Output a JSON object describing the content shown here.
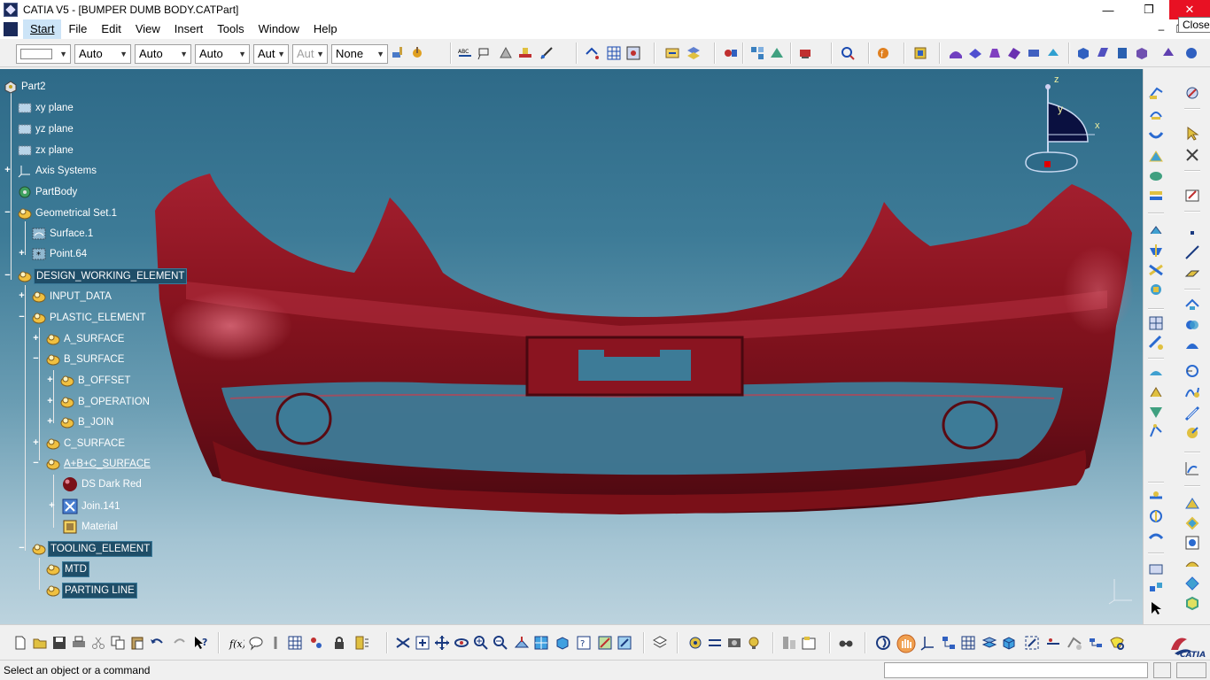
{
  "window": {
    "title": "CATIA V5 - [BUMPER DUMB BODY.CATPart]",
    "minimize_glyph": "—",
    "maximize_glyph": "❐",
    "close_glyph": "✕",
    "close_tooltip": "Close"
  },
  "menu": {
    "items": [
      "Start",
      "File",
      "Edit",
      "View",
      "Insert",
      "Tools",
      "Window",
      "Help"
    ],
    "mdi_minimize": "–",
    "mdi_restore": "❐",
    "mdi_close": "✕"
  },
  "toolbar_top": {
    "combos": [
      "",
      "Auto",
      "Auto",
      "Auto",
      "Aut",
      "Aut",
      "None"
    ]
  },
  "tree": {
    "nodes": [
      {
        "label": "Part2",
        "icon": "part-icon"
      },
      {
        "label": "xy plane",
        "icon": "plane-icon"
      },
      {
        "label": "yz plane",
        "icon": "plane-icon"
      },
      {
        "label": "zx plane",
        "icon": "plane-icon"
      },
      {
        "label": "Axis Systems",
        "icon": "axis-system-icon"
      },
      {
        "label": "PartBody",
        "icon": "partbody-icon"
      },
      {
        "label": "Geometrical Set.1",
        "icon": "geometrical-set-icon"
      },
      {
        "label": "Surface.1",
        "icon": "surface-icon"
      },
      {
        "label": "Point.64",
        "icon": "point-icon"
      },
      {
        "label": "DESIGN_WORKING_ELEMENT",
        "icon": "geometrical-set-icon"
      },
      {
        "label": "INPUT_DATA",
        "icon": "geometrical-set-icon"
      },
      {
        "label": "PLASTIC_ELEMENT",
        "icon": "geometrical-set-icon"
      },
      {
        "label": "A_SURFACE",
        "icon": "geometrical-set-icon"
      },
      {
        "label": "B_SURFACE",
        "icon": "geometrical-set-icon"
      },
      {
        "label": "B_OFFSET",
        "icon": "geometrical-set-icon"
      },
      {
        "label": "B_OPERATION",
        "icon": "geometrical-set-icon"
      },
      {
        "label": "B_JOIN",
        "icon": "geometrical-set-icon"
      },
      {
        "label": "C_SURFACE",
        "icon": "geometrical-set-icon"
      },
      {
        "label": "A+B+C_SURFACE",
        "icon": "geometrical-set-icon"
      },
      {
        "label": "DS Dark Red",
        "icon": "material-sphere-icon"
      },
      {
        "label": "Join.141",
        "icon": "join-icon"
      },
      {
        "label": "Material",
        "icon": "material-icon"
      },
      {
        "label": "TOOLING_ELEMENT",
        "icon": "geometrical-set-icon"
      },
      {
        "label": "MTD",
        "icon": "geometrical-set-icon"
      },
      {
        "label": "PARTING LINE",
        "icon": "geometrical-set-icon"
      }
    ]
  },
  "compass": {
    "z_label": "z",
    "y_label": "y",
    "x_label": "x"
  },
  "status": {
    "message": "Select an object or a command",
    "command_value": ""
  },
  "colors": {
    "bumper": "#8a1420",
    "viewport_top": "#2e6a88",
    "viewport_bottom": "#bcd3de"
  }
}
